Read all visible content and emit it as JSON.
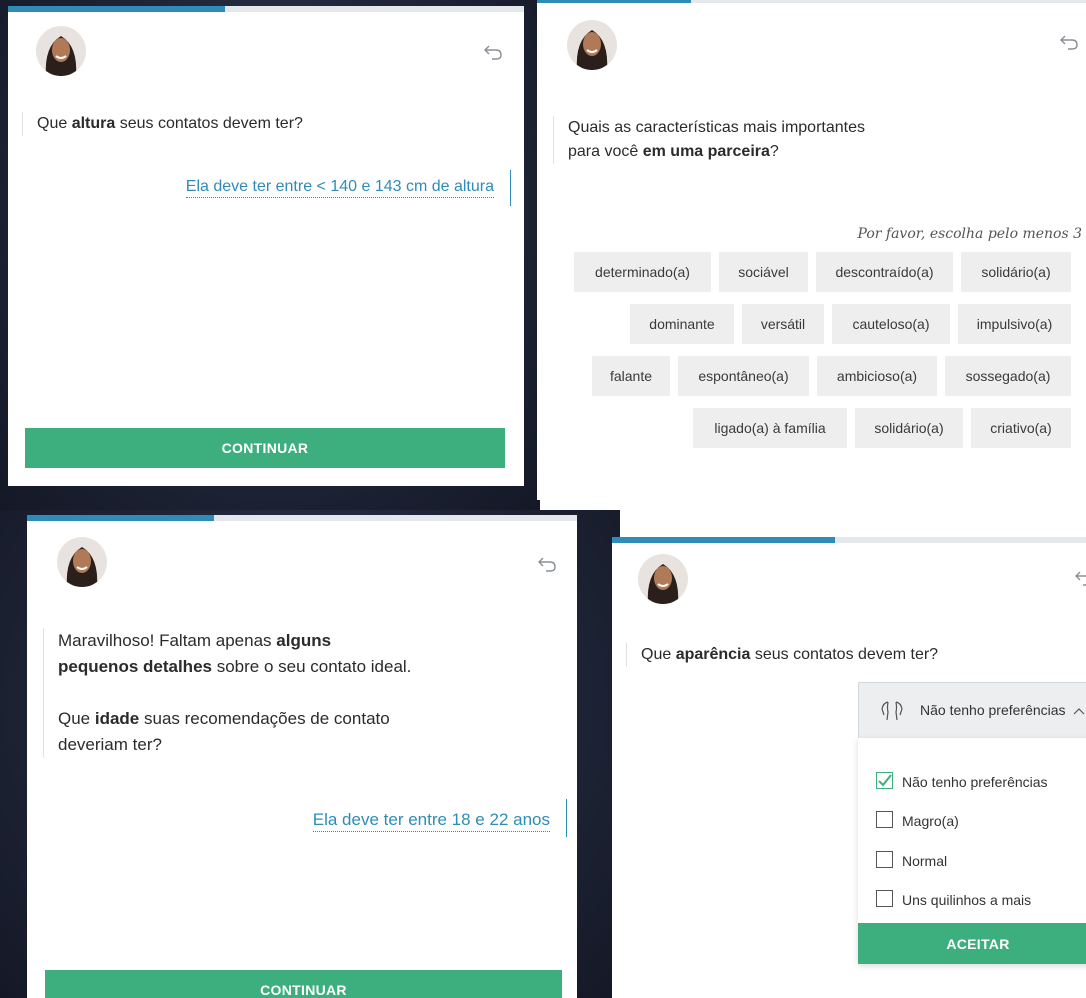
{
  "panel1": {
    "progress": 0.42,
    "question": {
      "pre": "Que ",
      "bold": "altura",
      "post": " seus contatos devem ter?"
    },
    "answer": "Ela deve ter entre < 140 e 143 cm de altura",
    "button": "CONTINUAR"
  },
  "panel2": {
    "progress": 0.28,
    "question": {
      "line1": "Quais as características mais importantes",
      "line2_pre": "para você ",
      "line2_bold": "em uma parceira",
      "line2_post": "?"
    },
    "hint": "Por favor, escolha pelo menos 3",
    "chips": [
      "determinado(a)",
      "sociável",
      "descontraído(a)",
      "solidário(a)",
      "dominante",
      "versátil",
      "cauteloso(a)",
      "impulsivo(a)",
      "falante",
      "espontâneo(a)",
      "ambicioso(a)",
      "sossegado(a)",
      "ligado(a) à família",
      "solidário(a)",
      "criativo(a)"
    ]
  },
  "panel3": {
    "progress": 0.34,
    "line1_pre": "Maravilhoso! Faltam apenas ",
    "line1_bold": "alguns",
    "line2_bold": "pequenos detalhes",
    "line2_post": " sobre o seu contato ideal.",
    "line3_pre": "Que ",
    "line3_bold": "idade",
    "line3_post": " suas recomendações de contato",
    "line4": "deveriam ter?",
    "answer": "Ela deve ter entre 18 e 22 anos",
    "button": "CONTINUAR"
  },
  "panel4": {
    "progress": 0.47,
    "question": {
      "pre": "Que ",
      "bold": "aparência",
      "post": " seus contatos devem ter?"
    },
    "dropdown_value": "Não tenho preferências",
    "options": [
      {
        "label": "Não tenho preferências",
        "checked": true
      },
      {
        "label": "Magro(a)",
        "checked": false
      },
      {
        "label": "Normal",
        "checked": false
      },
      {
        "label": "Uns quilinhos a mais",
        "checked": false
      }
    ],
    "button": "ACEITAR"
  },
  "colors": {
    "accent": "#2f8cb8",
    "button": "#3daf7f",
    "chip": "#eeeeee"
  },
  "icons": [
    "back-arrow-icon",
    "avatar-photo",
    "body-shape-icon",
    "chevron-up-icon",
    "checkmark-icon"
  ]
}
